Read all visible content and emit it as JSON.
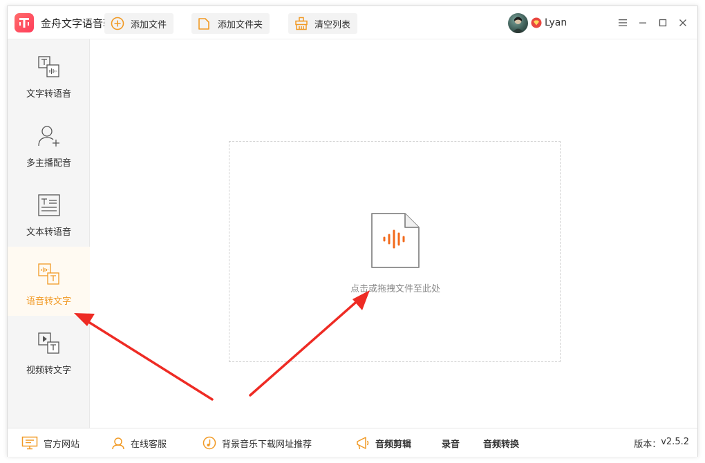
{
  "app": {
    "title": "金舟文字语音转换软件",
    "username": "Lyan",
    "colors": {
      "accent": "#f19a25",
      "brand_red": "#ff3d5a",
      "arrow_red": "#ee2b24",
      "waveform": "#f26a1b"
    }
  },
  "sidebar": {
    "items": [
      {
        "label": "文字转语音",
        "icon": "text-to-speech-icon"
      },
      {
        "label": "多主播配音",
        "icon": "multi-voice-user-icon"
      },
      {
        "label": "文本转语音",
        "icon": "document-to-speech-icon"
      },
      {
        "label": "语音转文字",
        "icon": "speech-to-text-icon",
        "active": true
      },
      {
        "label": "视频转文字",
        "icon": "video-to-text-icon"
      }
    ]
  },
  "toolbar": {
    "add_file": "添加文件",
    "add_folder": "添加文件夹",
    "clear_list": "清空列表"
  },
  "dropzone": {
    "hint": "点击或拖拽文件至此处"
  },
  "footer": {
    "website": "官方网站",
    "online_service": "在线客服",
    "bgm_recommend": "背景音乐下载网址推荐",
    "audio_edit": "音频剪辑",
    "record": "录音",
    "audio_convert": "音频转换",
    "version_label": "版本：",
    "version_value": "v2.5.2"
  }
}
